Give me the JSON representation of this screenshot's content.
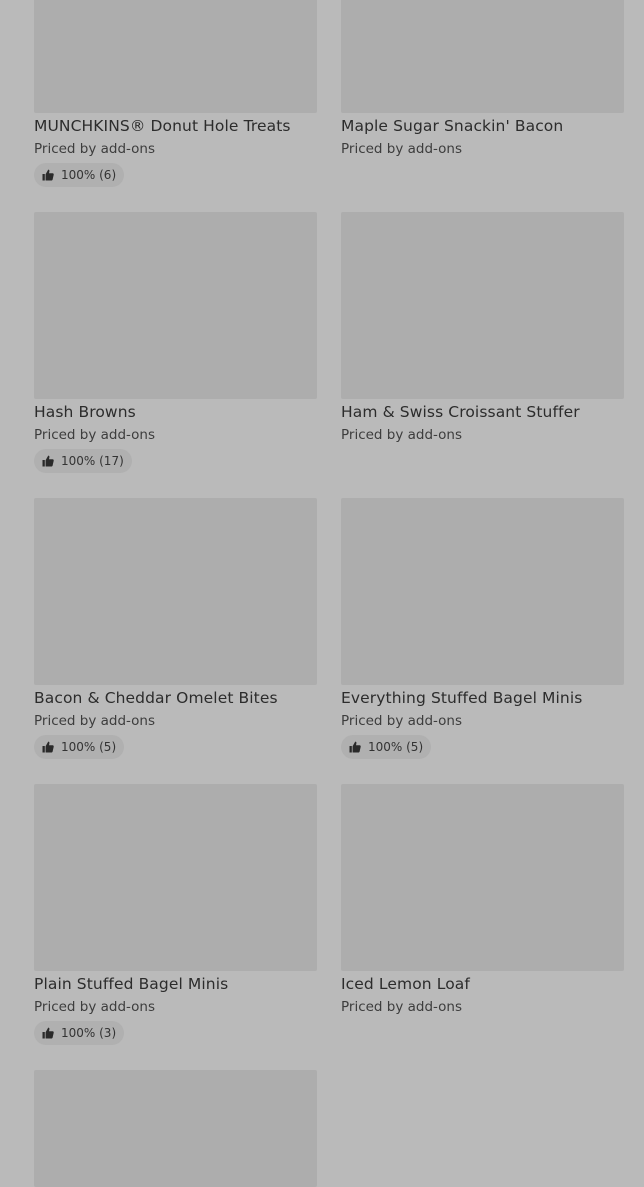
{
  "items": [
    {
      "name": "MUNCHKINS® Donut Hole Treats",
      "price": "Priced by add-ons",
      "rating": "100% (6)"
    },
    {
      "name": "Maple Sugar Snackin' Bacon",
      "price": "Priced by add-ons"
    },
    {
      "name": "Hash Browns",
      "price": "Priced by add-ons",
      "rating": "100% (17)"
    },
    {
      "name": "Ham & Swiss Croissant Stuffer",
      "price": "Priced by add-ons"
    },
    {
      "name": "Bacon & Cheddar Omelet Bites",
      "price": "Priced by add-ons",
      "rating": "100% (5)"
    },
    {
      "name": "Everything Stuffed Bagel Minis",
      "price": "Priced by add-ons",
      "rating": "100% (5)"
    },
    {
      "name": "Plain Stuffed Bagel Minis",
      "price": "Priced by add-ons",
      "rating": "100% (3)"
    },
    {
      "name": "Iced Lemon Loaf",
      "price": "Priced by add-ons"
    }
  ],
  "icons": {
    "rating": "thumbs-up-icon"
  }
}
